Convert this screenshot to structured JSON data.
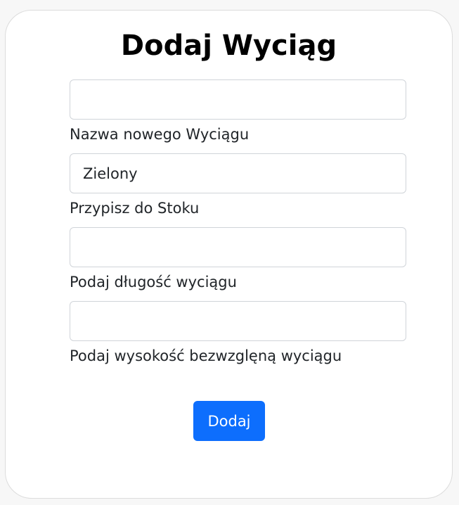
{
  "form": {
    "title": "Dodaj Wyciąg",
    "fields": [
      {
        "label": "Nazwa nowego Wyciągu",
        "value": ""
      },
      {
        "label": "Przypisz do Stoku",
        "value": "Zielony"
      },
      {
        "label": "Podaj długość wyciągu",
        "value": ""
      },
      {
        "label": "Podaj wysokość bezwzglęną wyciągu",
        "value": ""
      }
    ],
    "submit_label": "Dodaj"
  },
  "colors": {
    "primary": "#0d6efd",
    "page_background": "#f7f7f7",
    "card_background": "#ffffff"
  }
}
